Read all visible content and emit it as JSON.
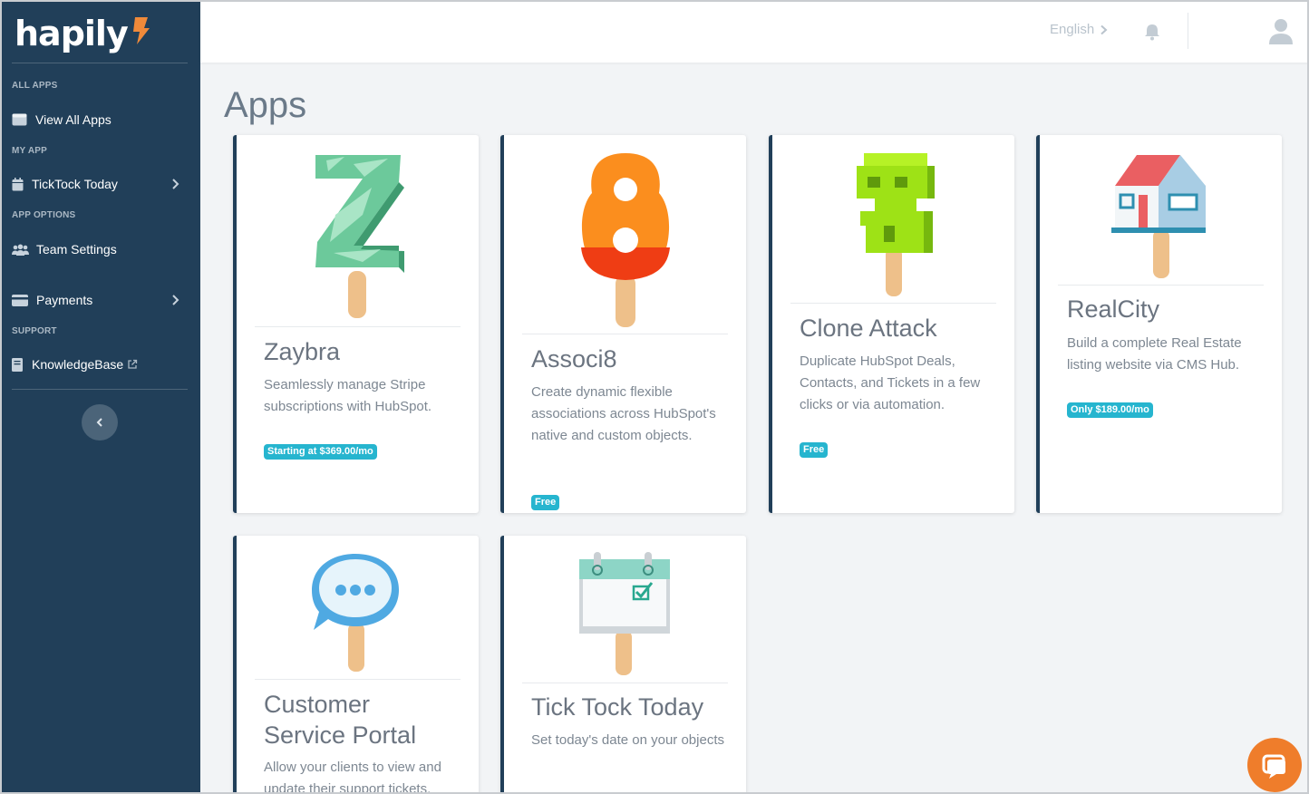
{
  "brand": {
    "name": "hapily"
  },
  "sidebar": {
    "sections": {
      "all_apps": "ALL APPS",
      "my_app": "MY APP",
      "app_options": "APP OPTIONS",
      "support": "SUPPORT"
    },
    "items": {
      "view_all_apps": "View All Apps",
      "ticktock_today": "TickTock Today",
      "team_settings": "Team Settings",
      "payments": "Payments",
      "knowledgebase": "KnowledgeBase"
    }
  },
  "header": {
    "language": "English"
  },
  "page": {
    "title": "Apps"
  },
  "cards": [
    {
      "title": "Zaybra",
      "description": "Seamlessly manage Stripe subscriptions with HubSpot.",
      "badge": "Starting at $369.00/mo"
    },
    {
      "title": "Associ8",
      "description": "Create dynamic flexible associations across HubSpot's native and custom objects.",
      "badge": "Free"
    },
    {
      "title": "Clone Attack",
      "description": "Duplicate HubSpot Deals, Contacts, and Tickets in a few clicks or via automation.",
      "badge": "Free"
    },
    {
      "title": "RealCity",
      "description": "Build a complete Real Estate listing website via CMS Hub.",
      "badge": "Only $189.00/mo"
    },
    {
      "title": "Customer Service Portal",
      "description": "Allow your clients to view and update their support tickets.",
      "badge": ""
    },
    {
      "title": "Tick Tock Today",
      "description": "Set today's date on your objects",
      "badge": ""
    }
  ],
  "colors": {
    "sidebar_bg": "#213f59",
    "badge": "#26b5cf",
    "accent_orange": "#ef7d2b"
  }
}
